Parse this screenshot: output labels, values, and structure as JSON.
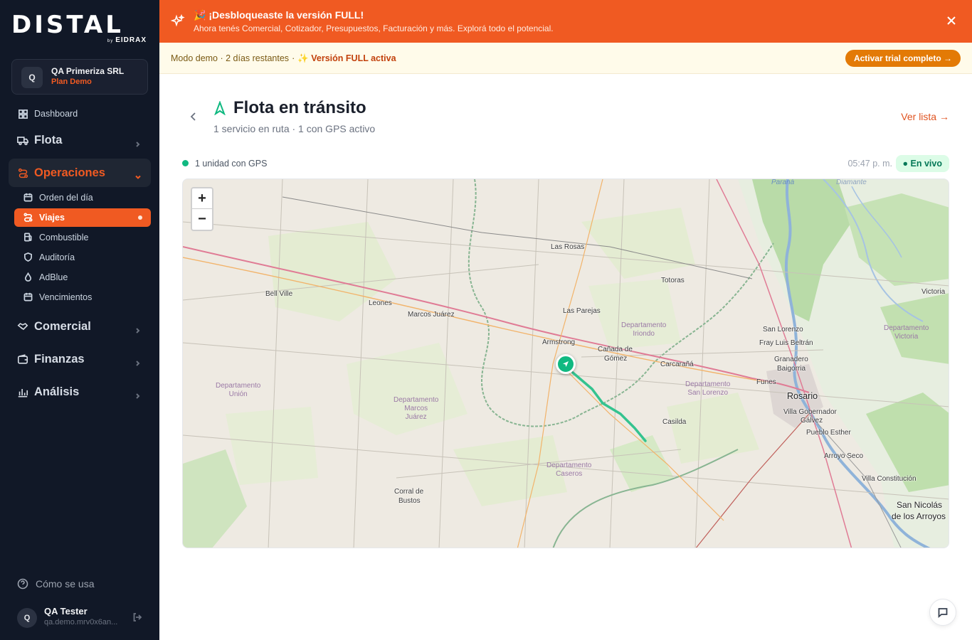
{
  "brand": {
    "name": "DISTAL",
    "by": "by",
    "maker": "EIDRAX"
  },
  "org": {
    "initial": "Q",
    "name": "QA Primeriza SRL",
    "plan": "Plan Demo"
  },
  "nav": {
    "dashboard": "Dashboard",
    "flota": "Flota",
    "operaciones": "Operaciones",
    "sub": {
      "orden": "Orden del día",
      "viajes": "Viajes",
      "combustible": "Combustible",
      "auditoria": "Auditoría",
      "adblue": "AdBlue",
      "vencimientos": "Vencimientos"
    },
    "comercial": "Comercial",
    "finanzas": "Finanzas",
    "analisis": "Análisis"
  },
  "help": "Cómo se usa",
  "user": {
    "initial": "Q",
    "name": "QA Tester",
    "email": "qa.demo.mrv0x6an..."
  },
  "promo": {
    "title": "🎉 ¡Desbloqueaste la versión FULL!",
    "desc": "Ahora tenés Comercial, Cotizador, Presupuestos, Facturación y más. Explorá todo el potencial."
  },
  "demo": {
    "mode": "Modo demo · 2 días restantes",
    "sep": "·",
    "full": "✨ Versión FULL activa",
    "trial_button": "Activar trial completo →"
  },
  "page": {
    "title": "Flota en tránsito",
    "subtitle": "1 servicio en ruta · 1 con GPS activo",
    "ver_lista": "Ver lista →"
  },
  "status": {
    "gps_units": "1 unidad con GPS",
    "time": "05:47 p. m.",
    "live": "● En vivo"
  },
  "map": {
    "zoom_in": "+",
    "zoom_out": "−",
    "rivers": {
      "parana": "Paraná",
      "diamante": "Diamante"
    },
    "places": {
      "las_rosas": "Las Rosas",
      "totoras": "Totoras",
      "bell_ville": "Bell Ville",
      "leones": "Leones",
      "marcos_juarez": "Marcos Juárez",
      "las_parejas": "Las Parejas",
      "armstrong": "Armstrong",
      "canada_de_gomez_1": "Cañada de",
      "canada_de_gomez_2": "Gómez",
      "carcarana": "Carcarañá",
      "san_lorenzo": "San Lorenzo",
      "fray_luis_beltran": "Fray Luis Beltrán",
      "granadero_1": "Granadero",
      "granadero_2": "Baigorria",
      "funes": "Funes",
      "villa_gobernador": "Villa Gobernador",
      "galvez": "Gálvez",
      "pueblo_esther": "Pueblo Esther",
      "arroyo_seco": "Arroyo Seco",
      "villa_constitucion": "Villa Constitución",
      "casilda": "Casilda",
      "corral_1": "Corral de",
      "corral_2": "Bustos",
      "victoria": "Victoria"
    },
    "cities": {
      "rosario": "Rosario",
      "san_nicolas_1": "San Nicolás",
      "san_nicolas_2": "de los Arroyos"
    },
    "departments": {
      "iriondo_1": "Departamento",
      "iriondo_2": "Iriondo",
      "union_1": "Departamento",
      "union_2": "Unión",
      "marcos_1": "Departamento",
      "marcos_2": "Marcos",
      "marcos_3": "Juárez",
      "sanlorenzo_1": "Departamento",
      "sanlorenzo_2": "San Lorenzo",
      "caseros_1": "Departamento",
      "caseros_2": "Caseros",
      "victoria_1": "Departamento",
      "victoria_2": "Victoria"
    }
  },
  "colors": {
    "accent": "#f05a22",
    "sidebar_bg": "#111827",
    "live_green": "#10b981",
    "trial_button": "#e37a06"
  }
}
